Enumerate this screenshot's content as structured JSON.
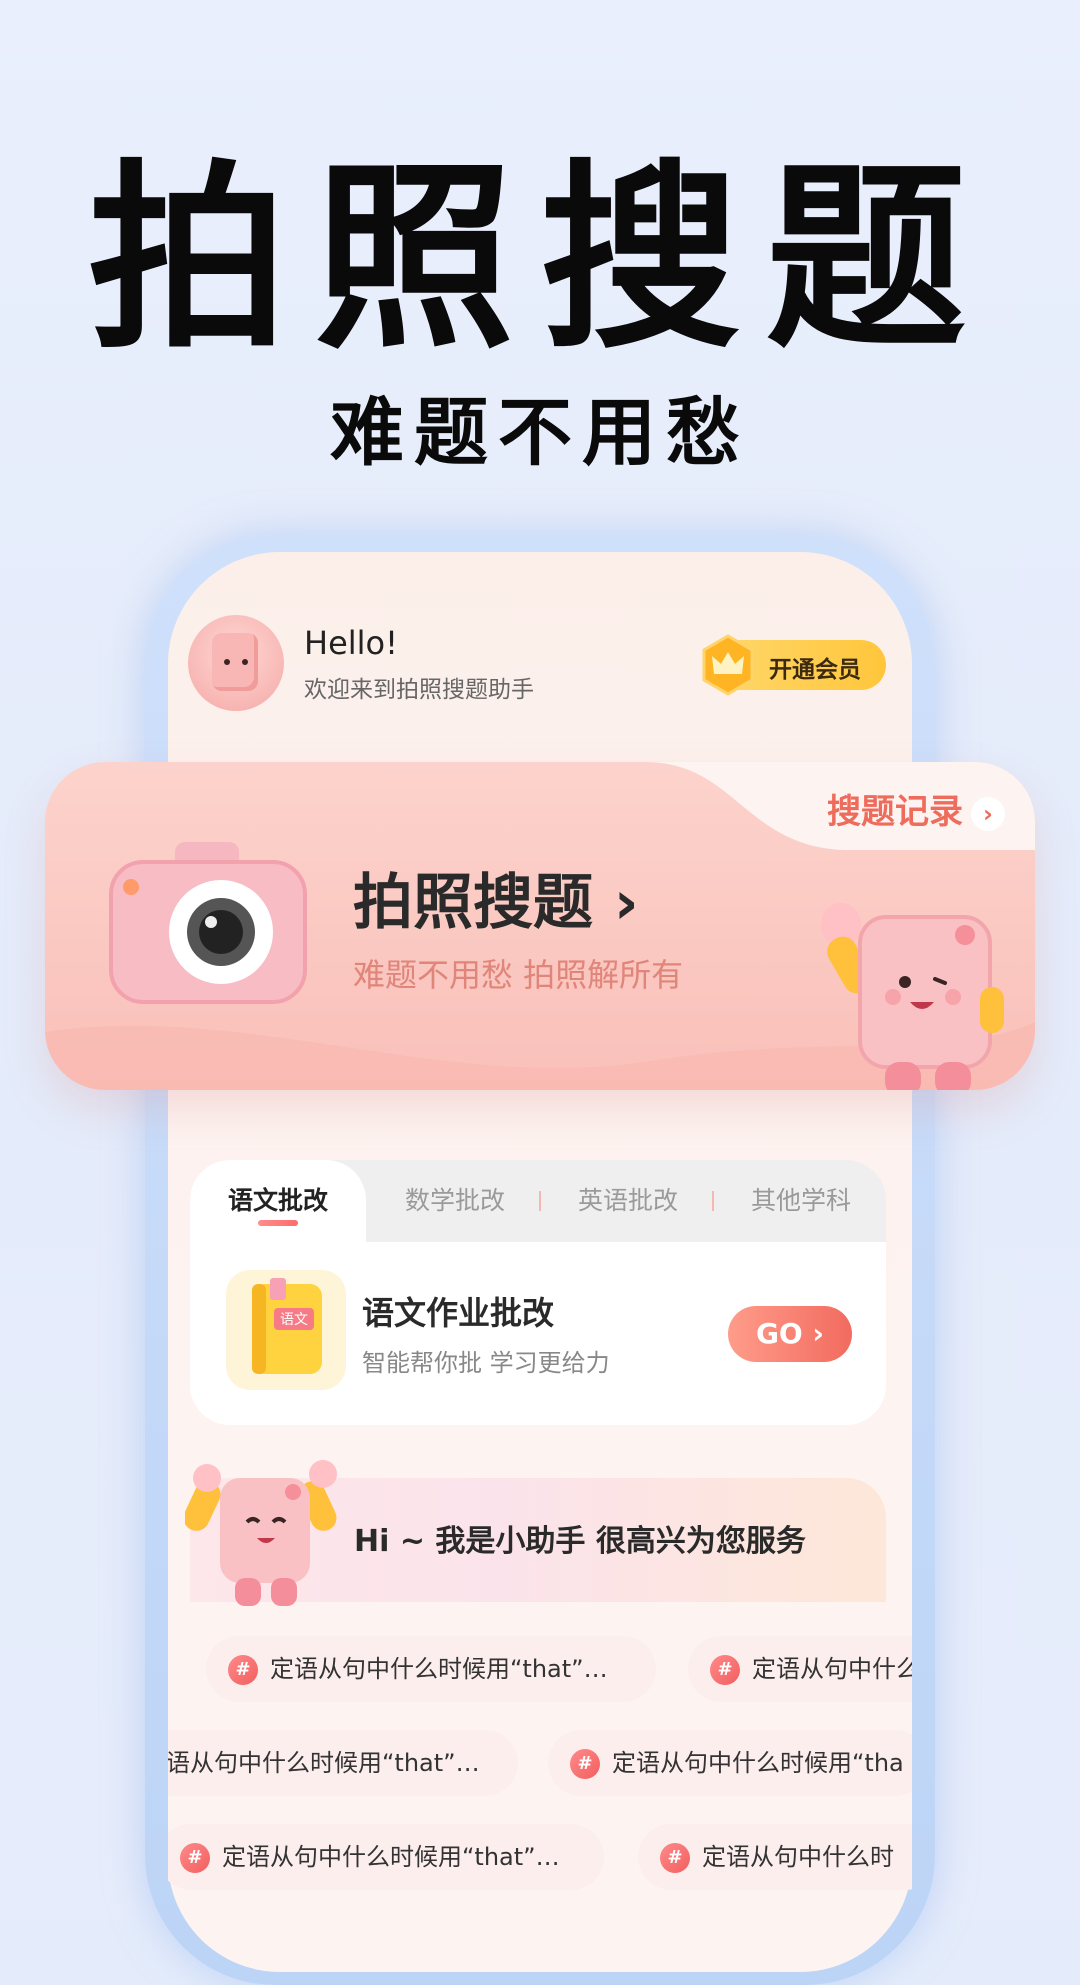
{
  "headline": "拍照搜题",
  "subheadline": "难题不用愁",
  "header": {
    "greeting": "Hello!",
    "welcome": "欢迎来到拍照搜题助手",
    "vip_label": "开通会员"
  },
  "banner": {
    "record_label": "搜题记录",
    "title": "拍照搜题 ›",
    "subtitle": "难题不用愁 拍照解所有"
  },
  "tabs": [
    {
      "label": "语文批改",
      "active": true
    },
    {
      "label": "数学批改",
      "active": false
    },
    {
      "label": "英语批改",
      "active": false
    },
    {
      "label": "其他学科",
      "active": false
    }
  ],
  "homework": {
    "book_tag": "语文",
    "title": "语文作业批改",
    "subtitle": "智能帮你批 学习更给力",
    "go_label": "GO ›"
  },
  "assistant": {
    "greeting": "Hi ~ 我是小助手 很高兴为您服务"
  },
  "questions": {
    "hash": "#",
    "rows": [
      [
        "定语从句中什么时候用“that”…",
        "定语从句中什么时"
      ],
      [
        "语从句中什么时候用“that”…",
        "定语从句中什么时候用“tha"
      ],
      [
        "定语从句中什么时候用“that”…",
        "定语从句中什么时"
      ]
    ]
  },
  "colors": {
    "accent": "#ee6c5c",
    "vip": "#ffc63b",
    "background": "#e4ebfa"
  }
}
